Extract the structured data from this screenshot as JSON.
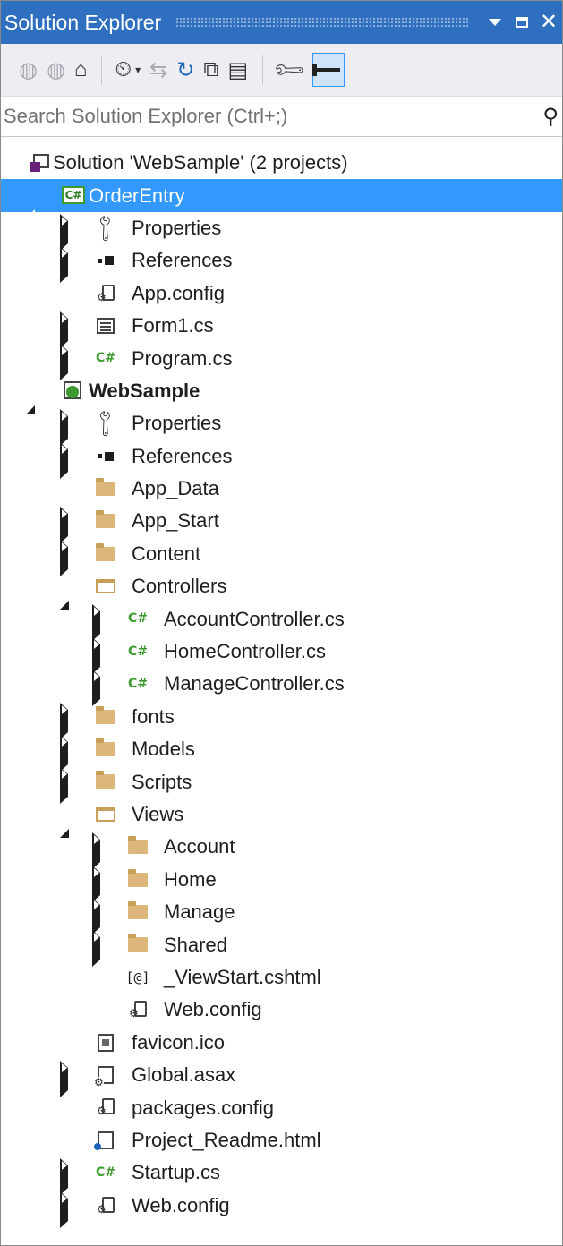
{
  "window": {
    "title": "Solution Explorer"
  },
  "search": {
    "placeholder": "Search Solution Explorer (Ctrl+;)"
  },
  "tree": {
    "rows": [
      {
        "label": "Solution 'WebSample' (2 projects)",
        "icon": "solution-icon",
        "level": 0,
        "expander": "none",
        "bold": false,
        "selected": false
      },
      {
        "label": "OrderEntry",
        "icon": "csharp-project-icon",
        "level": 1,
        "expander": "expanded",
        "bold": false,
        "selected": true
      },
      {
        "label": "Properties",
        "icon": "wrench-icon",
        "level": 2,
        "expander": "collapsed",
        "bold": false,
        "selected": false
      },
      {
        "label": "References",
        "icon": "references-icon",
        "level": 2,
        "expander": "collapsed",
        "bold": false,
        "selected": false
      },
      {
        "label": "App.config",
        "icon": "config-file-icon",
        "level": 2,
        "expander": "none",
        "bold": false,
        "selected": false
      },
      {
        "label": "Form1.cs",
        "icon": "form-icon",
        "level": 2,
        "expander": "collapsed",
        "bold": false,
        "selected": false
      },
      {
        "label": "Program.cs",
        "icon": "csharp-file-icon",
        "level": 2,
        "expander": "collapsed",
        "bold": false,
        "selected": false
      },
      {
        "label": "WebSample",
        "icon": "web-project-icon",
        "level": 1,
        "expander": "expanded",
        "bold": true,
        "selected": false
      },
      {
        "label": "Properties",
        "icon": "wrench-icon",
        "level": 2,
        "expander": "collapsed",
        "bold": false,
        "selected": false
      },
      {
        "label": "References",
        "icon": "references-icon",
        "level": 2,
        "expander": "collapsed",
        "bold": false,
        "selected": false
      },
      {
        "label": "App_Data",
        "icon": "folder-icon",
        "level": 2,
        "expander": "none",
        "bold": false,
        "selected": false
      },
      {
        "label": "App_Start",
        "icon": "folder-icon",
        "level": 2,
        "expander": "collapsed",
        "bold": false,
        "selected": false
      },
      {
        "label": "Content",
        "icon": "folder-icon",
        "level": 2,
        "expander": "collapsed",
        "bold": false,
        "selected": false
      },
      {
        "label": "Controllers",
        "icon": "open-folder-icon",
        "level": 2,
        "expander": "expanded",
        "bold": false,
        "selected": false
      },
      {
        "label": "AccountController.cs",
        "icon": "csharp-file-icon",
        "level": 3,
        "expander": "collapsed",
        "bold": false,
        "selected": false
      },
      {
        "label": "HomeController.cs",
        "icon": "csharp-file-icon",
        "level": 3,
        "expander": "collapsed",
        "bold": false,
        "selected": false
      },
      {
        "label": "ManageController.cs",
        "icon": "csharp-file-icon",
        "level": 3,
        "expander": "collapsed",
        "bold": false,
        "selected": false
      },
      {
        "label": "fonts",
        "icon": "folder-icon",
        "level": 2,
        "expander": "collapsed",
        "bold": false,
        "selected": false
      },
      {
        "label": "Models",
        "icon": "folder-icon",
        "level": 2,
        "expander": "collapsed",
        "bold": false,
        "selected": false
      },
      {
        "label": "Scripts",
        "icon": "folder-icon",
        "level": 2,
        "expander": "collapsed",
        "bold": false,
        "selected": false
      },
      {
        "label": "Views",
        "icon": "open-folder-icon",
        "level": 2,
        "expander": "expanded",
        "bold": false,
        "selected": false
      },
      {
        "label": "Account",
        "icon": "folder-icon",
        "level": 3,
        "expander": "collapsed",
        "bold": false,
        "selected": false
      },
      {
        "label": "Home",
        "icon": "folder-icon",
        "level": 3,
        "expander": "collapsed",
        "bold": false,
        "selected": false
      },
      {
        "label": "Manage",
        "icon": "folder-icon",
        "level": 3,
        "expander": "collapsed",
        "bold": false,
        "selected": false
      },
      {
        "label": "Shared",
        "icon": "folder-icon",
        "level": 3,
        "expander": "collapsed",
        "bold": false,
        "selected": false
      },
      {
        "label": "_ViewStart.cshtml",
        "icon": "razor-file-icon",
        "level": 3,
        "expander": "none",
        "bold": false,
        "selected": false
      },
      {
        "label": "Web.config",
        "icon": "config-file-icon",
        "level": 3,
        "expander": "none",
        "bold": false,
        "selected": false
      },
      {
        "label": "favicon.ico",
        "icon": "icon-file-icon",
        "level": 2,
        "expander": "none",
        "bold": false,
        "selected": false
      },
      {
        "label": "Global.asax",
        "icon": "asax-file-icon",
        "level": 2,
        "expander": "collapsed",
        "bold": false,
        "selected": false
      },
      {
        "label": "packages.config",
        "icon": "config-file-icon",
        "level": 2,
        "expander": "none",
        "bold": false,
        "selected": false
      },
      {
        "label": "Project_Readme.html",
        "icon": "html-file-icon",
        "level": 2,
        "expander": "none",
        "bold": false,
        "selected": false
      },
      {
        "label": "Startup.cs",
        "icon": "csharp-file-icon",
        "level": 2,
        "expander": "collapsed",
        "bold": false,
        "selected": false
      },
      {
        "label": "Web.config",
        "icon": "config-file-icon",
        "level": 2,
        "expander": "collapsed",
        "bold": false,
        "selected": false
      }
    ]
  },
  "colors": {
    "titlebar": "#2f6fbf",
    "selection": "#3399ff",
    "toolbar": "#eeeef2",
    "folder": "#dcb67a",
    "csharp": "#3d9a2e"
  }
}
